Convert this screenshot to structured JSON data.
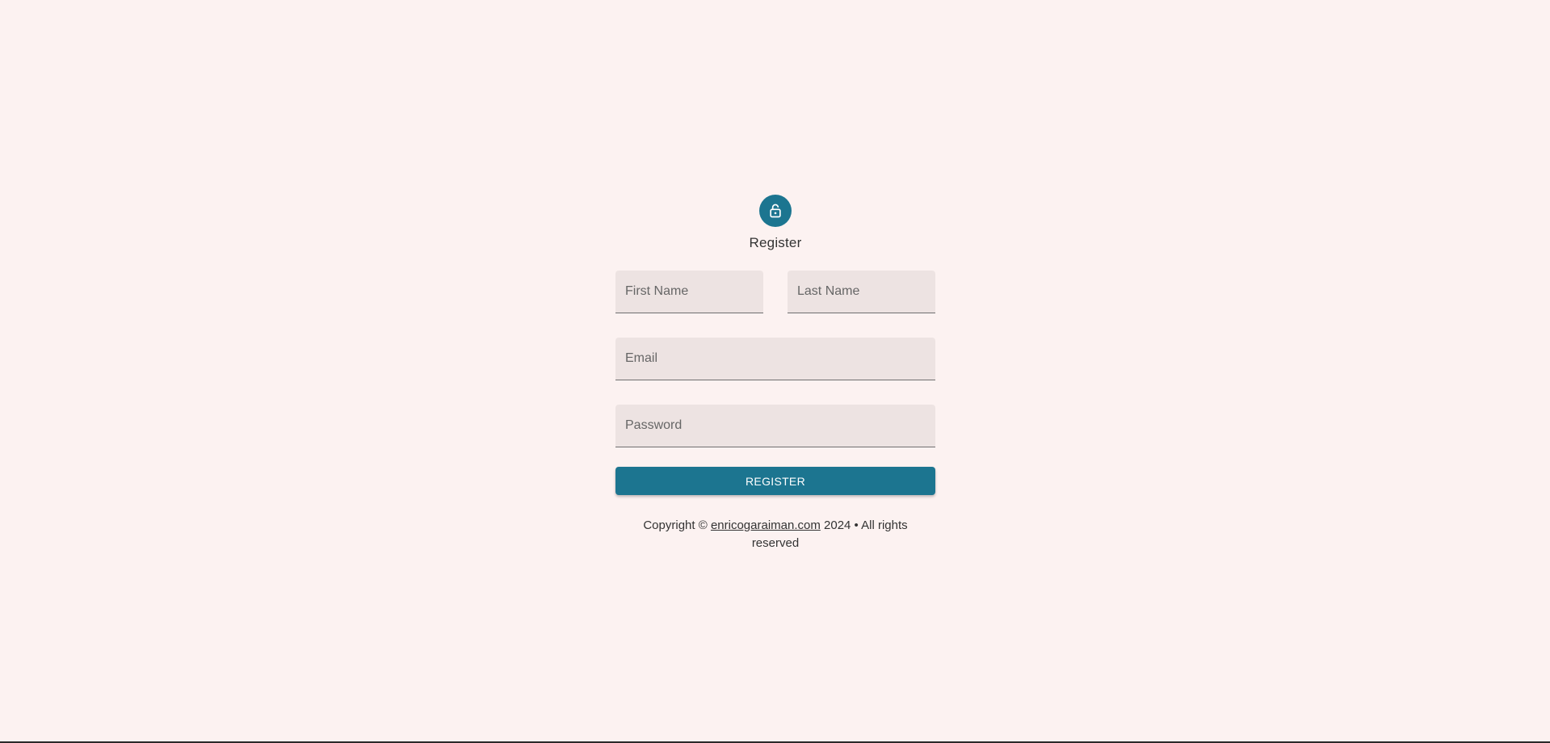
{
  "colors": {
    "background": "#fcf2f1",
    "accent": "#1c7590",
    "field_bg": "#ede3e2"
  },
  "header": {
    "icon": "lock-icon",
    "title": "Register"
  },
  "form": {
    "first_name_placeholder": "First Name",
    "last_name_placeholder": "Last Name",
    "email_placeholder": "Email",
    "password_placeholder": "Password",
    "submit_label": "REGISTER"
  },
  "footer": {
    "prefix": "Copyright © ",
    "link_text": "enricogaraiman.com",
    "suffix": " 2024 • All rights reserved"
  }
}
